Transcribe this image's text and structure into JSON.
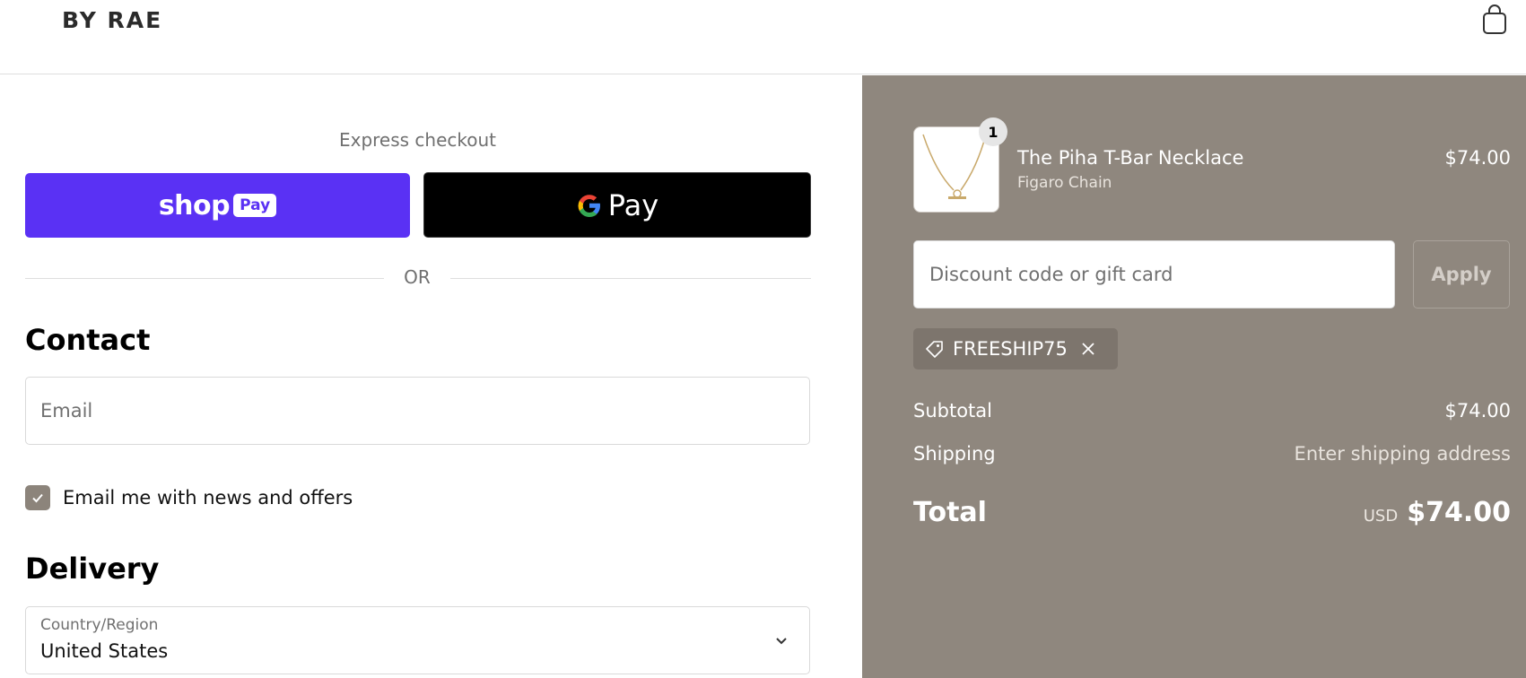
{
  "header": {
    "logo": "BY RAE",
    "cart_icon": "shopping-bag-icon"
  },
  "express": {
    "label": "Express checkout",
    "shop_pay": {
      "word": "shop",
      "badge": "Pay",
      "color": "#5a31f4"
    },
    "google_pay": {
      "text": "Pay"
    },
    "or_label": "OR"
  },
  "contact": {
    "title": "Contact",
    "email_placeholder": "Email",
    "newsletter_label": "Email me with news and offers",
    "newsletter_checked": true
  },
  "delivery": {
    "title": "Delivery",
    "country_label": "Country/Region",
    "country_value": "United States"
  },
  "summary": {
    "item": {
      "quantity": "1",
      "name": "The Piha T-Bar Necklace",
      "variant": "Figaro Chain",
      "price": "$74.00"
    },
    "discount_placeholder": "Discount code or gift card",
    "apply_label": "Apply",
    "applied_code": "FREESHIP75",
    "subtotal_label": "Subtotal",
    "subtotal_value": "$74.00",
    "shipping_label": "Shipping",
    "shipping_value": "Enter shipping address",
    "total_label": "Total",
    "total_currency": "USD",
    "total_value": "$74.00",
    "panel_color": "#8f877e"
  }
}
